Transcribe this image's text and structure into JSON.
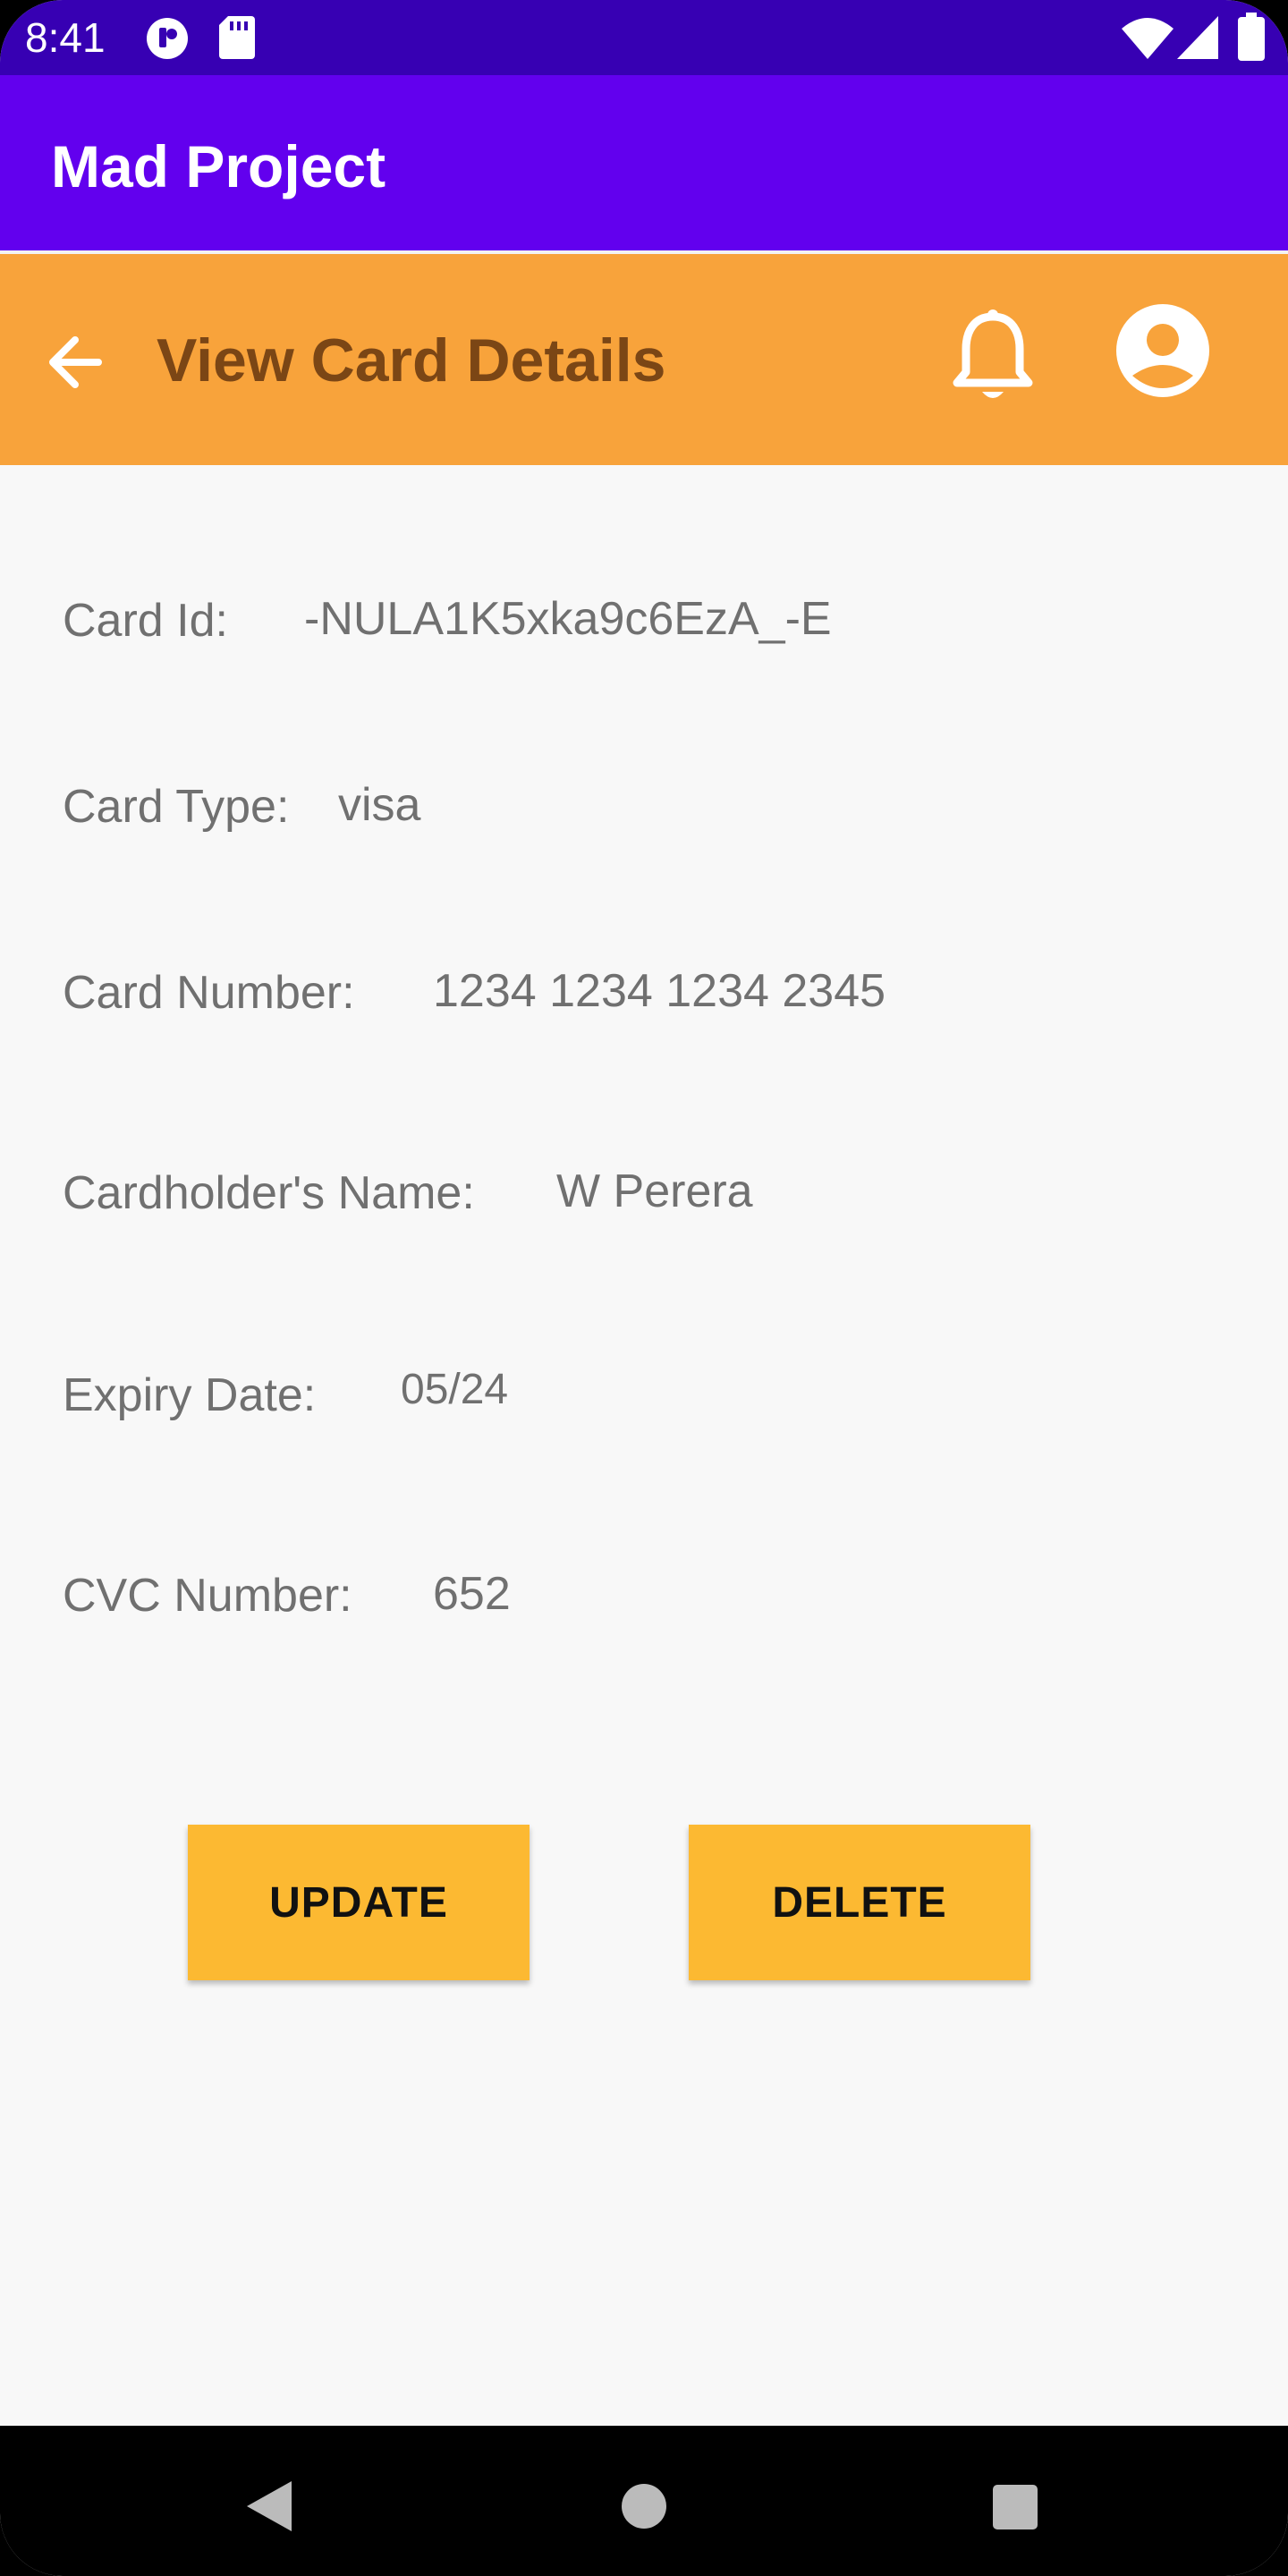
{
  "status_bar": {
    "time": "8:41",
    "icons": [
      "app-notification-icon",
      "sd-card-icon",
      "wifi-icon",
      "cell-signal-icon",
      "battery-icon"
    ]
  },
  "app_bar": {
    "title": "Mad Project"
  },
  "header": {
    "title": "View Card Details",
    "icons": [
      "back-arrow-icon",
      "bell-icon",
      "account-circle-icon"
    ]
  },
  "card": {
    "id_label": "Card Id:",
    "id_value": "-NULA1K5xka9c6EzA_-E",
    "type_label": "Card Type:",
    "type_value": "visa",
    "number_label": "Card Number:",
    "number_value": "1234 1234 1234 2345",
    "holder_label": "Cardholder's Name:",
    "holder_value": "W Perera",
    "expiry_label": "Expiry Date:",
    "expiry_value": "05/24",
    "cvc_label": "CVC Number:",
    "cvc_value": "652"
  },
  "actions": {
    "update_label": "UPDATE",
    "delete_label": "DELETE"
  },
  "nav_bar": {
    "icons": [
      "back-triangle-icon",
      "home-circle-icon",
      "recents-square-icon"
    ]
  },
  "colors": {
    "status_bar": "#3700b3",
    "app_bar": "#6200ee",
    "header": "#f8a33b",
    "header_title": "#7b4615",
    "button": "#fcb932",
    "background": "#f8f8f8"
  }
}
